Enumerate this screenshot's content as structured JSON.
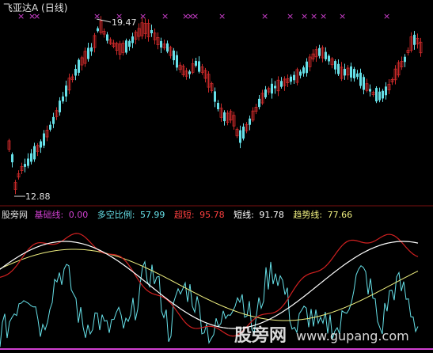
{
  "top_panel": {
    "title": "飞亚达A (日线)",
    "title_color": "#e0e0e0",
    "high_label": "19.47",
    "low_label": "12.88",
    "up_color": "#cc2a2a",
    "down_color": "#66e0e8",
    "marker_glyph": "×",
    "marker_color": "#d040d0"
  },
  "indicator": {
    "legend": [
      {
        "text": "股旁网",
        "color": "#e0e0e0"
      },
      {
        "text": "基础线:",
        "color": "#d040d0"
      },
      {
        "text": "0.00",
        "color": "#d040d0"
      },
      {
        "text": "多空比例:",
        "color": "#66e0e8"
      },
      {
        "text": "57.99",
        "color": "#66e0e8"
      },
      {
        "text": "超短:",
        "color": "#ff4040"
      },
      {
        "text": "95.78",
        "color": "#ff4040"
      },
      {
        "text": "短线:",
        "color": "#ffffff"
      },
      {
        "text": "91.78",
        "color": "#ffffff"
      },
      {
        "text": "趋势线:",
        "color": "#f0f080"
      },
      {
        "text": "77.66",
        "color": "#f0f080"
      }
    ],
    "series_colors": {
      "ratio": "#66e0e8",
      "super_short": "#d02020",
      "short": "#ffffff",
      "trend": "#f0f080",
      "base": "#d040d0"
    }
  },
  "watermark": {
    "cn": "股旁网",
    "url": "www.gupang.com"
  }
}
